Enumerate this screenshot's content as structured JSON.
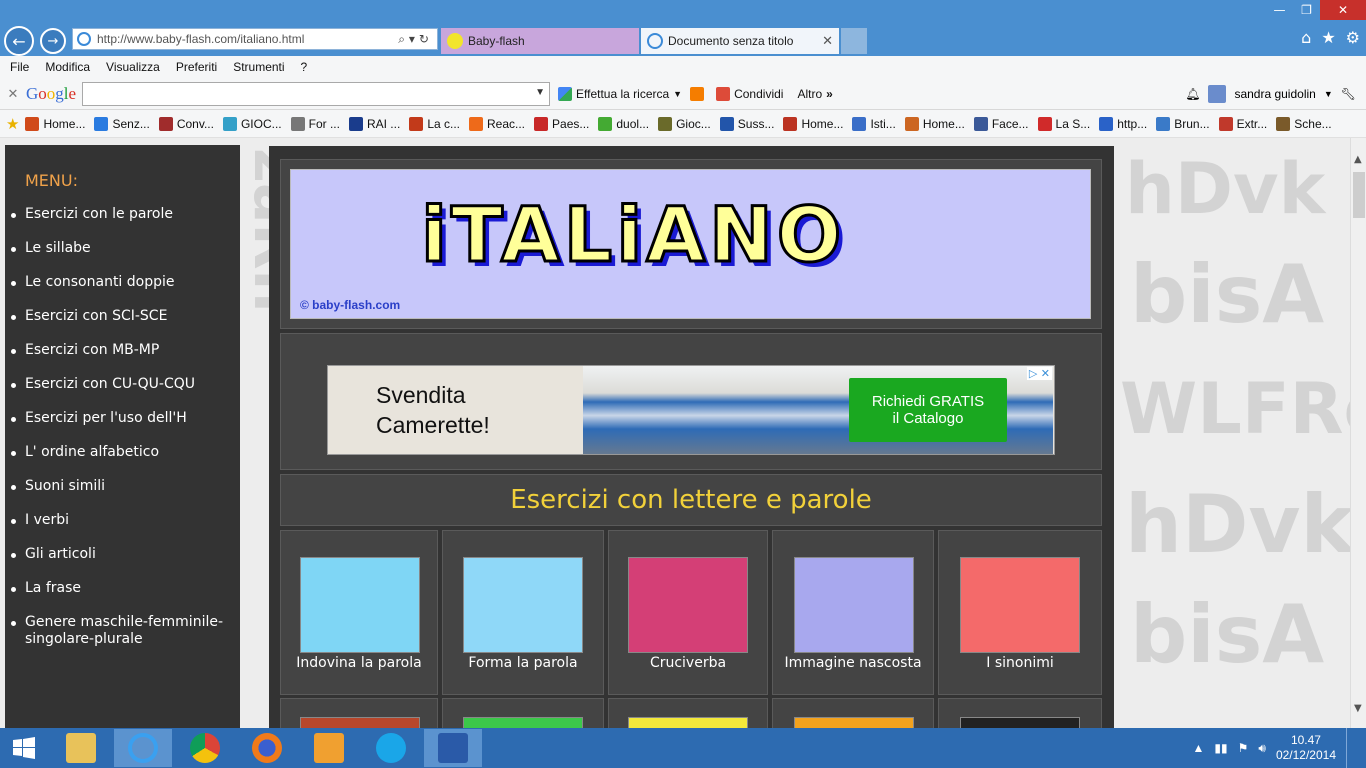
{
  "browser": {
    "address_url": "http://www.baby-flash.com/italiano.html",
    "tabs": [
      {
        "label": "Baby-flash"
      },
      {
        "label": "Documento senza titolo"
      }
    ],
    "menu": [
      "File",
      "Modifica",
      "Visualizza",
      "Preferiti",
      "Strumenti",
      "?"
    ]
  },
  "google_toolbar": {
    "logo": "Google",
    "search_value": "",
    "search_button": "Effettua la ricerca",
    "share_label": "Condividi",
    "more_label": "Altro",
    "user_name": "sandra guidolin"
  },
  "favorites": [
    "Home...",
    "Senz...",
    "Conv...",
    "GIOC...",
    "For ...",
    "RAI ...",
    "La c...",
    "Reac...",
    "Paes...",
    "duol...",
    "Gioc...",
    "Suss...",
    "Home...",
    "Isti...",
    "Home...",
    "Face...",
    "La S...",
    "http...",
    "Brun...",
    "Extr...",
    "Sche..."
  ],
  "favorite_colors": [
    "#d04a1a",
    "#2a7be0",
    "#a02c2c",
    "#34a0c8",
    "#777777",
    "#1a3c8c",
    "#c23a1a",
    "#ee6a1a",
    "#c82828",
    "#44aa33",
    "#6a6a2a",
    "#2255aa",
    "#bb3322",
    "#3a6ec8",
    "#cc6622",
    "#3b5998",
    "#d02a2a",
    "#2a62c8",
    "#3a7ac8",
    "#c0392b",
    "#7a5a2a"
  ],
  "left_menu": {
    "title": "MENU:",
    "items": [
      "Esercizi con le parole",
      "Le sillabe",
      "Le consonanti doppie",
      "Esercizi con SCI-SCE",
      "Esercizi con MB-MP",
      "Esercizi con CU-QU-CQU",
      "Esercizi per l'uso dell'H",
      "L' ordine alfabetico",
      "Suoni simili",
      "I verbi",
      "Gli articoli",
      "La frase",
      "Genere maschile-femminile-singolare-plurale"
    ]
  },
  "banner": {
    "title": "iTALiANO",
    "copyright": "© baby-flash.com"
  },
  "ad": {
    "headline_line1": "Svendita",
    "headline_line2": "Camerette!",
    "button_line1": "Richiedi GRATIS",
    "button_line2": "il Catalogo",
    "choice": "▷ ✕"
  },
  "section": {
    "title": "Esercizi con lettere e parole"
  },
  "games": [
    {
      "label": "Indovina la parola",
      "color": "#7fd6f5"
    },
    {
      "label": "Forma la parola",
      "color": "#8fd8f8"
    },
    {
      "label": "Cruciverba",
      "color": "#d43f76"
    },
    {
      "label": "Immagine nascosta",
      "color": "#a8a8ee"
    },
    {
      "label": "I sinonimi",
      "color": "#f46a6a"
    }
  ],
  "games_row2_colors": [
    "#b8472c",
    "#3cc84a",
    "#f3e83a",
    "#f2a21e",
    "#222222"
  ],
  "taskbar": {
    "time": "10.47",
    "date": "02/12/2014"
  }
}
